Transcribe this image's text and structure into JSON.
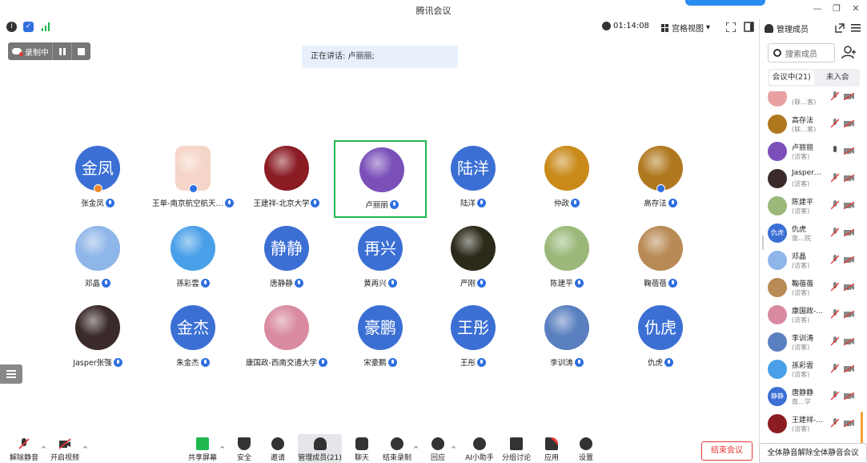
{
  "window": {
    "title": "腾讯会议"
  },
  "toolbar": {
    "timer": "01:14:08",
    "view_label": "宫格视图"
  },
  "recording": {
    "label": "录制中"
  },
  "speaking": {
    "text": "正在讲话: 卢丽丽;"
  },
  "participants": [
    {
      "name": "张金凤",
      "avatar_text": "金凤",
      "avatar_color": "#3b6fd4",
      "host": true
    },
    {
      "name": "王单-南京航空航天…",
      "avatar_text": "",
      "avatar_color": "#f5d5c8",
      "host": true
    },
    {
      "name": "王建祥-北京大学",
      "avatar_text": "",
      "avatar_color": "#8b1c24",
      "host": false
    },
    {
      "name": "卢丽丽",
      "avatar_text": "",
      "avatar_color": "#7a4fb8",
      "host": false,
      "active": true
    },
    {
      "name": "陆洋",
      "avatar_text": "陆洋",
      "avatar_color": "#3b6fd4",
      "host": false
    },
    {
      "name": "仲政",
      "avatar_text": "",
      "avatar_color": "#c98a1a",
      "host": false
    },
    {
      "name": "高存法",
      "avatar_text": "",
      "avatar_color": "#b0781e",
      "host": true
    },
    {
      "name": "邓晶",
      "avatar_text": "",
      "avatar_color": "#8fb6e8",
      "host": false
    },
    {
      "name": "孫彩雲",
      "avatar_text": "",
      "avatar_color": "#4aa0e8",
      "host": false
    },
    {
      "name": "唐静静",
      "avatar_text": "静静",
      "avatar_color": "#3b6fd4",
      "host": false
    },
    {
      "name": "黄再兴",
      "avatar_text": "再兴",
      "avatar_color": "#3b6fd4",
      "host": false
    },
    {
      "name": "严刚",
      "avatar_text": "",
      "avatar_color": "#2c2a1a",
      "host": false
    },
    {
      "name": "陈建平",
      "avatar_text": "",
      "avatar_color": "#9bb87a",
      "host": false
    },
    {
      "name": "鞠蓓蓓",
      "avatar_text": "",
      "avatar_color": "#b88a55",
      "host": false
    },
    {
      "name": "Jasper张强",
      "avatar_text": "",
      "avatar_color": "#3a2a2a",
      "host": false
    },
    {
      "name": "朱金杰",
      "avatar_text": "金杰",
      "avatar_color": "#3b6fd4",
      "host": false
    },
    {
      "name": "康国政-西南交通大学",
      "avatar_text": "",
      "avatar_color": "#d98aa0",
      "host": false
    },
    {
      "name": "宋豪鹏",
      "avatar_text": "豪鹏",
      "avatar_color": "#3b6fd4",
      "host": false
    },
    {
      "name": "王彤",
      "avatar_text": "王彤",
      "avatar_color": "#3b6fd4",
      "host": false
    },
    {
      "name": "李训涛",
      "avatar_text": "",
      "avatar_color": "#5a7fc0",
      "host": false
    },
    {
      "name": "仇虎",
      "avatar_text": "仇虎",
      "avatar_color": "#3b6fd4",
      "host": false
    }
  ],
  "bottom": {
    "unmute": "解除静音",
    "video": "开启视频",
    "share": "共享屏幕",
    "security": "安全",
    "invite": "邀请",
    "manage": "管理成员(21)",
    "chat": "聊天",
    "stop_record": "结束录制",
    "react": "回应",
    "ai": "AI小助手",
    "breakout": "分组讨论",
    "apps": "应用",
    "settings": "设置",
    "end": "结束会议"
  },
  "panel": {
    "title": "管理成员",
    "search_placeholder": "搜索成员",
    "tab_in": "会议中(21)",
    "tab_out": "未入会",
    "mute_all": "全体静音解除全体静音会议",
    "members": [
      {
        "name": "",
        "role": "(联…客)",
        "avatar_text": "",
        "avatar_color": "#e8a0a0"
      },
      {
        "name": "高存法",
        "role": "(联…客)",
        "avatar_text": "",
        "avatar_color": "#b0781e"
      },
      {
        "name": "卢丽丽",
        "role": "(访客)",
        "avatar_text": "",
        "avatar_color": "#7a4fb8"
      },
      {
        "name": "Jasper…",
        "role": "(访客)",
        "avatar_text": "",
        "avatar_color": "#3a2a2a"
      },
      {
        "name": "陈建平",
        "role": "(访客)",
        "avatar_text": "",
        "avatar_color": "#9bb87a"
      },
      {
        "name": "仇虎",
        "role": "南…院",
        "avatar_text": "仇虎",
        "avatar_color": "#3b6fd4"
      },
      {
        "name": "邓晶",
        "role": "(访客)",
        "avatar_text": "",
        "avatar_color": "#8fb6e8"
      },
      {
        "name": "鞠蓓蓓",
        "role": "(访客)",
        "avatar_text": "",
        "avatar_color": "#b88a55"
      },
      {
        "name": "康国政-…",
        "role": "(访客)",
        "avatar_text": "",
        "avatar_color": "#d98aa0"
      },
      {
        "name": "李训涛",
        "role": "(访客)",
        "avatar_text": "",
        "avatar_color": "#5a7fc0"
      },
      {
        "name": "孫彩雲",
        "role": "(访客)",
        "avatar_text": "",
        "avatar_color": "#4aa0e8"
      },
      {
        "name": "唐静静",
        "role": "南…学",
        "avatar_text": "静静",
        "avatar_color": "#3b6fd4"
      },
      {
        "name": "王建祥-…",
        "role": "(访客)",
        "avatar_text": "",
        "avatar_color": "#8b1c24"
      }
    ]
  },
  "colors": {
    "accent": "#2f6fe0",
    "active_border": "#1fb850",
    "danger": "#e53935"
  }
}
